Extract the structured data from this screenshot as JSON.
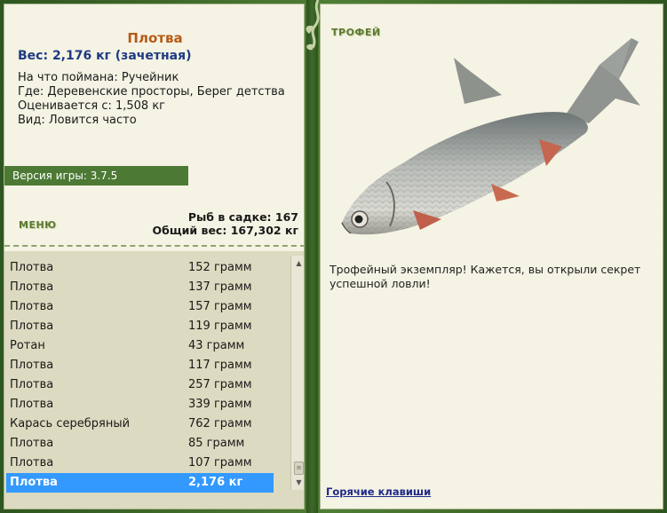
{
  "fish": {
    "title": "Плотва",
    "weight": "Вес: 2,176 кг (зачетная)",
    "caught_on": "На что поймана: Ручейник",
    "location": "Где: Деревенские просторы, Берег детства",
    "estimate": "Оценивается с: 1,508 кг",
    "kind": "Вид: Ловится часто"
  },
  "version": "Версия игры: 3.7.5",
  "menu_label": "МЕНЮ",
  "stats": {
    "count": "Рыб в садке: 167",
    "total": "Общий вес: 167,302 кг"
  },
  "catch_list": [
    {
      "name": "Плотва",
      "weight": "152 грамм"
    },
    {
      "name": "Плотва",
      "weight": "137 грамм"
    },
    {
      "name": "Плотва",
      "weight": "157 грамм"
    },
    {
      "name": "Плотва",
      "weight": "119 грамм"
    },
    {
      "name": "Ротан",
      "weight": "43 грамм"
    },
    {
      "name": "Плотва",
      "weight": "117 грамм"
    },
    {
      "name": "Плотва",
      "weight": "257 грамм"
    },
    {
      "name": "Плотва",
      "weight": "339 грамм"
    },
    {
      "name": "Карась серебряный",
      "weight": "762 грамм"
    },
    {
      "name": "Плотва",
      "weight": "85 грамм"
    },
    {
      "name": "Плотва",
      "weight": "107 грамм"
    },
    {
      "name": "Плотва",
      "weight": "2,176 кг"
    }
  ],
  "trophy": {
    "label": "ТРОФЕЙ",
    "text": "Трофейный экземпляр! Кажется, вы открыли секрет успешной ловли!",
    "hotkeys": "Горячие клавиши"
  },
  "colors": {
    "frame": "#3f6a2a",
    "panel": "#f5f3e4",
    "list_bg": "#dcdac0",
    "selected": "#3399ff",
    "title": "#b65a16",
    "weight": "#1e3a82"
  }
}
